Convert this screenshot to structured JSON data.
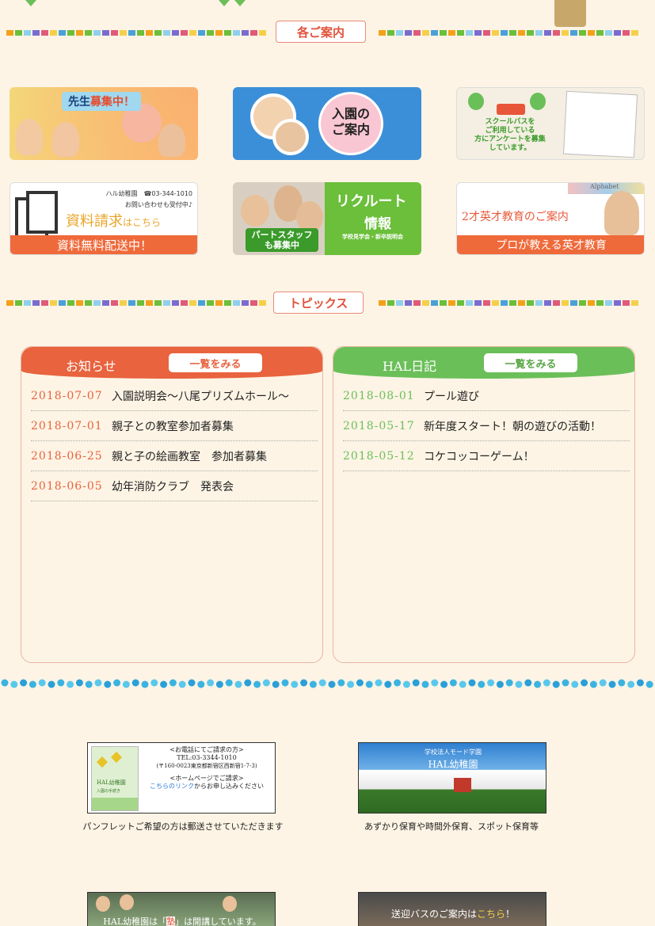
{
  "sections": {
    "guide_label": "各ご案内",
    "topics_label": "トピックス"
  },
  "banners": {
    "teacher": {
      "prefix": "先生",
      "highlight": "募集中！"
    },
    "admission": {
      "line1": "入園の",
      "line2": "ご案内"
    },
    "bus": {
      "line1": "スクールバスを",
      "line2": "ご利用している",
      "line3": "方にアンケートを募集",
      "line4": "しています。"
    },
    "docs": {
      "org": "ハル幼稚園",
      "tel": "☎03-344-1010",
      "note": "お問い合わせも受付中♪",
      "main_a": "資料請求",
      "main_b": "はこちら",
      "footer": "資料無料配送中！"
    },
    "recruit": {
      "line1": "リクルート",
      "line2": "情報",
      "sub": "学校見学会・新卒説明会",
      "part1": "パートスタッフ",
      "part2": "も募集中"
    },
    "english": {
      "title": "2才英才教育のご案内",
      "footer": "プロが教える英才教育",
      "deco": "Alphabet"
    }
  },
  "news_panel": {
    "title": "お知らせ",
    "more": "一覧をみる",
    "accent": "#e8633e",
    "items": [
      {
        "date": "2018-07-07",
        "title": "入園説明会～八尾プリズムホール～"
      },
      {
        "date": "2018-07-01",
        "title": "親子との教室参加者募集"
      },
      {
        "date": "2018-06-25",
        "title": "親と子の絵画教室　参加者募集"
      },
      {
        "date": "2018-06-05",
        "title": "幼年消防クラブ　発表会"
      }
    ]
  },
  "diary_panel": {
    "title": "HAL日記",
    "more": "一覧をみる",
    "accent": "#6bbf59",
    "items": [
      {
        "date": "2018-08-01",
        "title": "プール遊び"
      },
      {
        "date": "2018-05-17",
        "title": "新年度スタート！朝の遊びの活動！"
      },
      {
        "date": "2018-05-12",
        "title": "コケコッコーゲーム！"
      }
    ]
  },
  "info": {
    "pamphlet": {
      "phone_head": "<お電話にてご請求の方>",
      "tel": "TEL:03-3344-1010",
      "address": "(〒160-0023東京都新宿区西新宿1-7-3)",
      "web_head": "<ホームページでご請求>",
      "link": "こちらのリンク",
      "link_suffix": "からお申し込みください",
      "book_title": "HAL幼稚園",
      "book_sub": "入園の手続き",
      "caption": "パンフレットご希望の方は郵送させていただきます"
    },
    "building": {
      "line1": "学校法人モード学園",
      "line2": "HAL幼稚園",
      "caption": "あずかり保育や時間外保育、スポット保育等"
    },
    "kids": {
      "text_a": "HAL幼稚園は「",
      "text_b": "塾",
      "text_c": "」は開講しています。"
    },
    "bus2": {
      "text_a": "送迎バスのご案内は",
      "text_b": "こちら",
      "text_c": "！"
    }
  }
}
